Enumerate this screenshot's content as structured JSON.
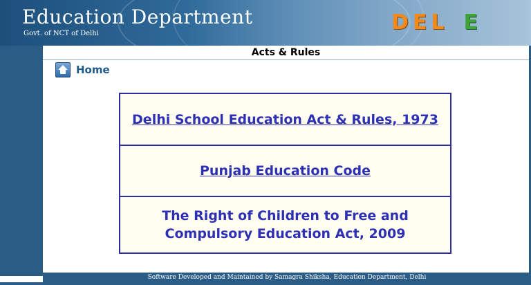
{
  "header": {
    "title": "Education Department",
    "subtitle": "Govt. of NCT of Delhi",
    "logo_part1": "DEL",
    "logo_part2": "E"
  },
  "page": {
    "title": "Acts & Rules"
  },
  "nav": {
    "home_label": "Home"
  },
  "acts": [
    {
      "label": "Delhi School Education Act & Rules, 1973"
    },
    {
      "label": "Punjab Education Code"
    },
    {
      "label_line1": "The Right of Children to Free and",
      "label_line2": "Compulsory Education Act, 2009"
    }
  ],
  "footer": {
    "text": "Software Developed and Maintained by Samagra Shiksha, Education Department, Delhi"
  },
  "colors": {
    "sidebar": "#2b5c85",
    "link": "#2d2fb5",
    "cell_bg": "#fffef0",
    "logo_orange": "#f08a1c",
    "logo_green": "#3fa43a"
  }
}
